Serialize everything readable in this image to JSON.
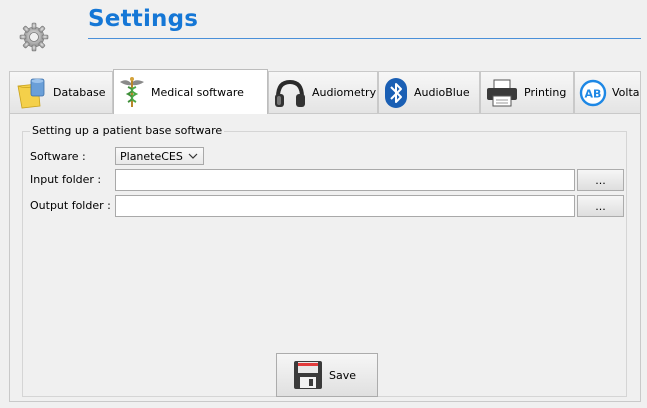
{
  "header": {
    "title": "Settings",
    "icon": "gear-icon"
  },
  "tabs": [
    {
      "label": "Database",
      "icon": "database-icon",
      "active": false
    },
    {
      "label": "Medical software",
      "icon": "caduceus-icon",
      "active": true
    },
    {
      "label": "Audiometry",
      "icon": "headphones-icon",
      "active": false
    },
    {
      "label": "AudioBlue",
      "icon": "bluetooth-icon",
      "active": false
    },
    {
      "label": "Printing",
      "icon": "printer-icon",
      "active": false
    },
    {
      "label": "Volta",
      "icon": "ab-logo-icon",
      "active": false
    }
  ],
  "medical_software": {
    "group_title": "Setting up a patient base software",
    "software_label": "Software :",
    "software_value": "PlaneteCES",
    "input_folder_label": "Input folder :",
    "input_folder_value": "",
    "output_folder_label": "Output folder :",
    "output_folder_value": "",
    "browse_label": "...",
    "save_label": "Save"
  },
  "colors": {
    "accent": "#1577d6",
    "bluetooth": "#1a5fb4",
    "ab_logo": "#1e88e5"
  }
}
